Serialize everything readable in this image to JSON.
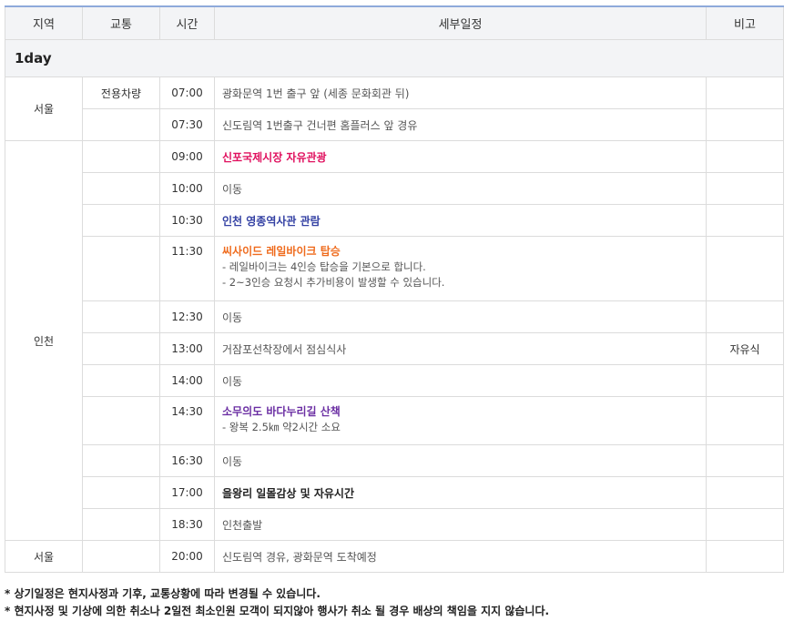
{
  "headers": {
    "region": "지역",
    "transport": "교통",
    "time": "시간",
    "detail": "세부일정",
    "note": "비고"
  },
  "day_label": "1day",
  "rows": [
    {
      "region": "서울",
      "transport": "전용차량",
      "time": "07:00",
      "detail": "광화문역 1번 출구 앞 (세종 문화회관 뒤)",
      "note": ""
    },
    {
      "region": "",
      "transport": "",
      "time": "07:30",
      "detail": "신도림역 1번출구 건너편 홈플러스 앞 경유",
      "note": ""
    },
    {
      "region": "인천",
      "transport": "",
      "time": "09:00",
      "detail": "신포국제시장 자유관광",
      "note": ""
    },
    {
      "transport": "",
      "time": "10:00",
      "detail": "이동",
      "note": ""
    },
    {
      "transport": "",
      "time": "10:30",
      "detail": "인천 영종역사관 관람",
      "note": ""
    },
    {
      "transport": "",
      "time": "11:30",
      "detail": "씨사이드 레일바이크 탑승",
      "sub": [
        "- 레일바이크는 4인승 탑승을 기본으로 합니다.",
        "- 2~3인승 요청시 추가비용이 발생할 수 있습니다."
      ],
      "note": ""
    },
    {
      "transport": "",
      "time": "12:30",
      "detail": "이동",
      "note": ""
    },
    {
      "transport": "",
      "time": "13:00",
      "detail": "거잠포선착장에서 점심식사",
      "note": "자유식"
    },
    {
      "transport": "",
      "time": "14:00",
      "detail": "이동",
      "note": ""
    },
    {
      "transport": "",
      "time": "14:30",
      "detail": "소무의도 바다누리길 산책",
      "sub": [
        "- 왕복 2.5㎞ 약2시간 소요"
      ],
      "note": ""
    },
    {
      "transport": "",
      "time": "16:30",
      "detail": "이동",
      "note": ""
    },
    {
      "transport": "",
      "time": "17:00",
      "detail": "을왕리 일몰감상 및 자유시간",
      "note": ""
    },
    {
      "transport": "",
      "time": "18:30",
      "detail": "인천출발",
      "note": ""
    },
    {
      "region": "서울",
      "transport": "",
      "time": "20:00",
      "detail": "신도림역 경유, 광화문역 도착예정",
      "note": ""
    }
  ],
  "footnotes": [
    "* 상기일정은 현지사정과 기후, 교통상황에 따라 변경될 수 있습니다.",
    "* 현지사정 및 기상에 의한 취소나 2일전 최소인원 모객이 되지않아 행사가 취소 될 경우 배상의 책임을 지지 않습니다."
  ],
  "colors": {
    "header_top_border": "#8eaadb",
    "highlight_pink": "#e0115f",
    "highlight_blue": "#3340a3",
    "highlight_orange": "#ef6b1d",
    "highlight_purple": "#6b2fa3"
  }
}
